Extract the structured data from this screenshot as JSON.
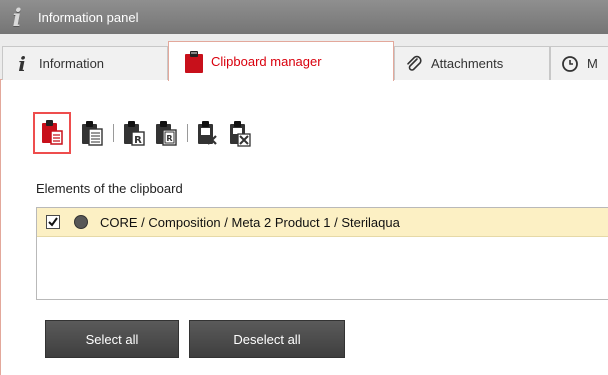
{
  "window": {
    "title": "Information panel"
  },
  "tabs": [
    {
      "label": "Information",
      "icon": "info-icon"
    },
    {
      "label": "Clipboard manager",
      "icon": "clipboard-icon",
      "active": true
    },
    {
      "label": "Attachments",
      "icon": "paperclip-icon"
    },
    {
      "label": "M",
      "icon": "clock-icon"
    }
  ],
  "toolbar": {
    "buttons": [
      {
        "icon": "clipboard-paste-icon",
        "selected": true
      },
      {
        "icon": "clipboard-list-icon"
      },
      {
        "icon": "clipboard-r-icon"
      },
      {
        "icon": "clipboard-r-outline-icon"
      },
      {
        "icon": "clipboard-delete-icon"
      },
      {
        "icon": "clipboard-delete-all-icon"
      }
    ]
  },
  "clipboard": {
    "section_label": "Elements of the clipboard",
    "items": [
      {
        "checked": true,
        "status": "dark-grey",
        "text": "CORE / Composition / Meta 2 Product 1 / Sterilaqua"
      }
    ]
  },
  "actions": {
    "select_all": "Select all",
    "deselect_all": "Deselect all"
  },
  "colors": {
    "accent": "#d9000d",
    "highlight_border": "#ee4d4d",
    "row_highlight": "#fcf0c4",
    "tab_border": "#e3a89b",
    "button_bg": "#4a4a4a"
  }
}
